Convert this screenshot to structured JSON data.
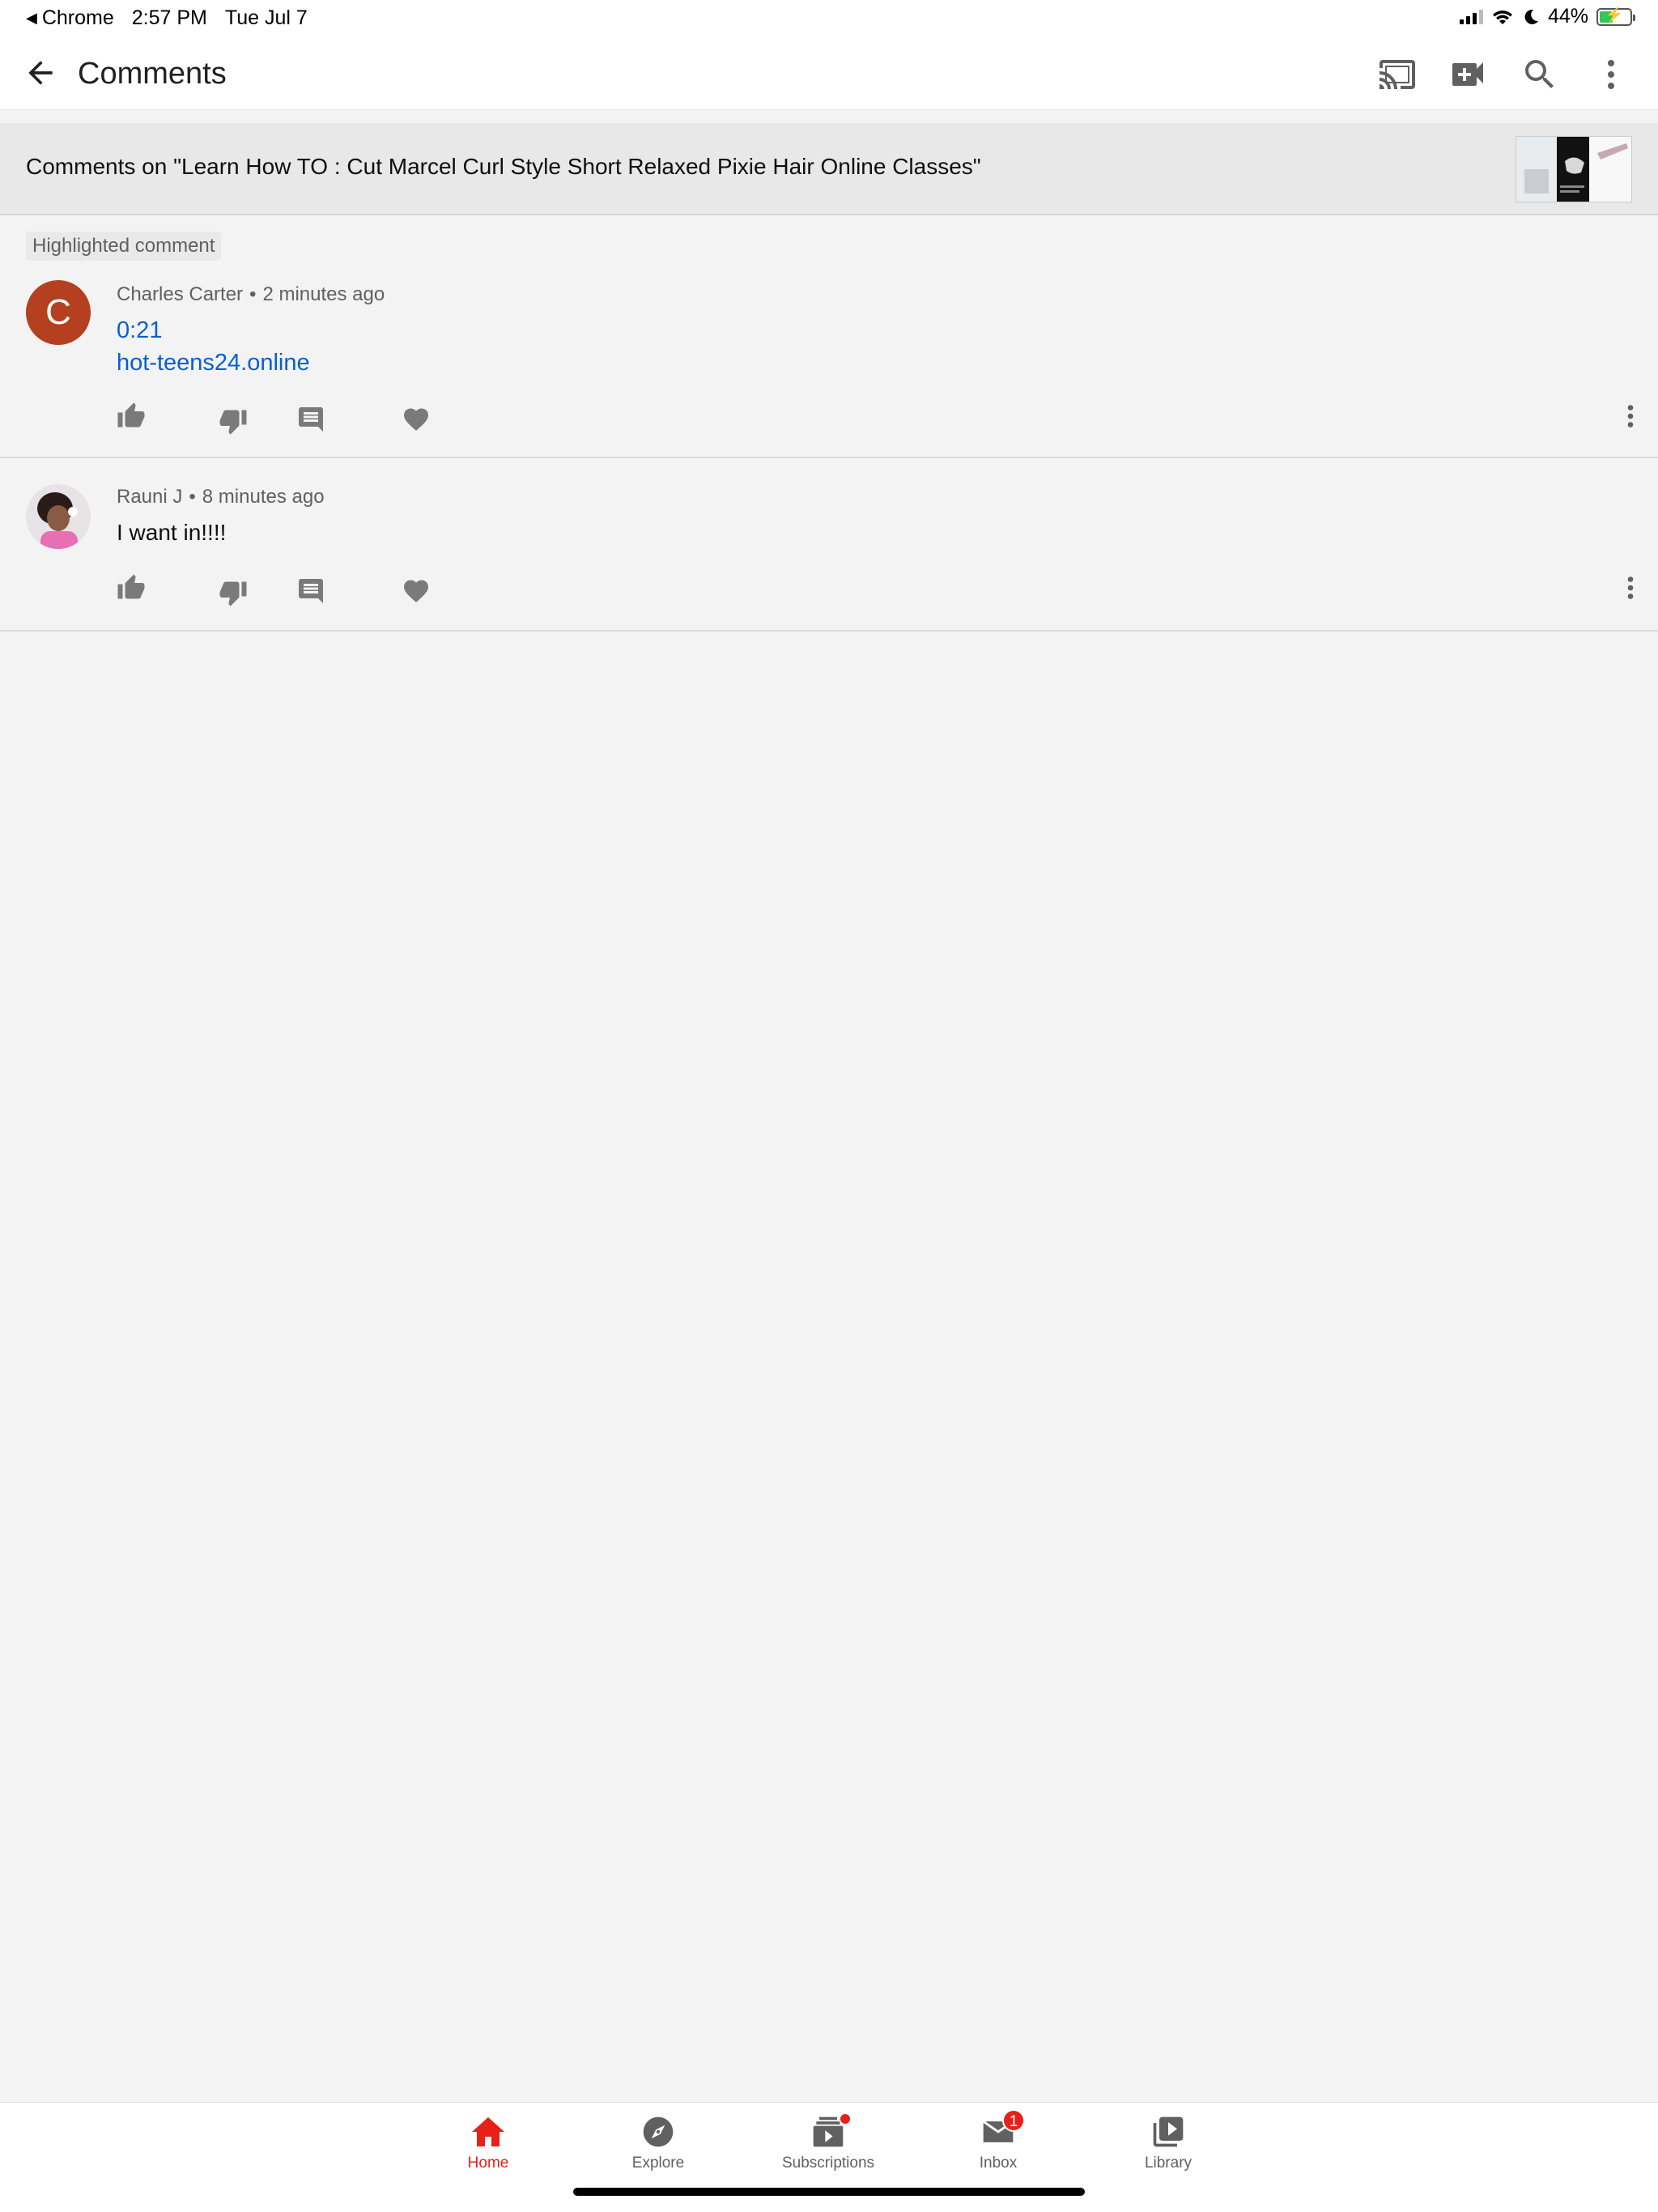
{
  "status_bar": {
    "back_app": "Chrome",
    "time": "2:57 PM",
    "date": "Tue Jul 7",
    "battery": "44%",
    "battery_level": 0.44,
    "icons": [
      "signal-icon",
      "wifi-icon",
      "do-not-disturb-icon",
      "battery-icon"
    ]
  },
  "header": {
    "title": "Comments",
    "icons": [
      "back-arrow-icon",
      "cast-icon",
      "video-add-icon",
      "search-icon",
      "more-vert-icon"
    ]
  },
  "banner": {
    "text": "Comments on \"Learn How TO : Cut Marcel Curl Style Short Relaxed Pixie Hair Online Classes\""
  },
  "comments": [
    {
      "highlight_label": "Highlighted comment",
      "avatar_letter": "C",
      "avatar_color": "#b5401f",
      "author": "Charles Carter",
      "time": "2 minutes ago",
      "timestamp_link": "0:21",
      "link": "hot-teens24.online"
    },
    {
      "author": "Rauni J",
      "time": "8 minutes ago",
      "text": "I want in!!!!"
    }
  ],
  "bottom_nav": [
    {
      "label": "Home",
      "icon": "home-icon",
      "active": true
    },
    {
      "label": "Explore",
      "icon": "explore-icon"
    },
    {
      "label": "Subscriptions",
      "icon": "subscriptions-icon"
    },
    {
      "label": "Inbox",
      "icon": "inbox-icon",
      "badge": "1"
    },
    {
      "label": "Library",
      "icon": "library-icon"
    }
  ],
  "colors": {
    "accent_red": "#e62117",
    "link_blue": "#065fd4",
    "icon_gray": "#606060"
  }
}
